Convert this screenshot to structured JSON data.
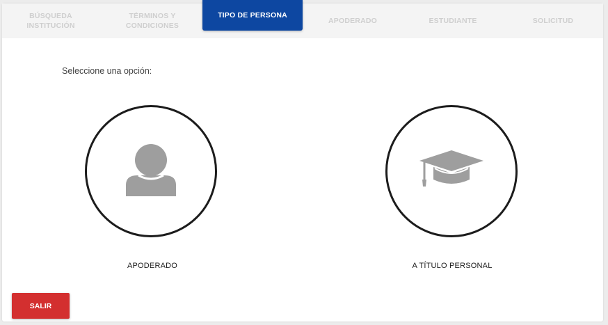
{
  "stepper": {
    "steps": [
      {
        "label": "BÚSQUEDA\nINSTITUCIÓN",
        "active": false
      },
      {
        "label": "TÉRMINOS Y\nCONDICIONES",
        "active": false
      },
      {
        "label": "TIPO DE PERSONA",
        "active": true
      },
      {
        "label": "APODERADO",
        "active": false
      },
      {
        "label": "ESTUDIANTE",
        "active": false
      },
      {
        "label": "SOLICITUD",
        "active": false
      }
    ],
    "active_color": "#0d47a1",
    "inactive_color": "#cfcfcf"
  },
  "main": {
    "prompt": "Seleccione una opción:",
    "options": [
      {
        "label": "APODERADO",
        "icon": "person-icon"
      },
      {
        "label": "A TÍTULO PERSONAL",
        "icon": "graduation-cap-icon"
      }
    ],
    "icon_color": "#9e9e9e"
  },
  "footer": {
    "exit_label": "SALIR",
    "exit_color": "#d32f2f"
  }
}
